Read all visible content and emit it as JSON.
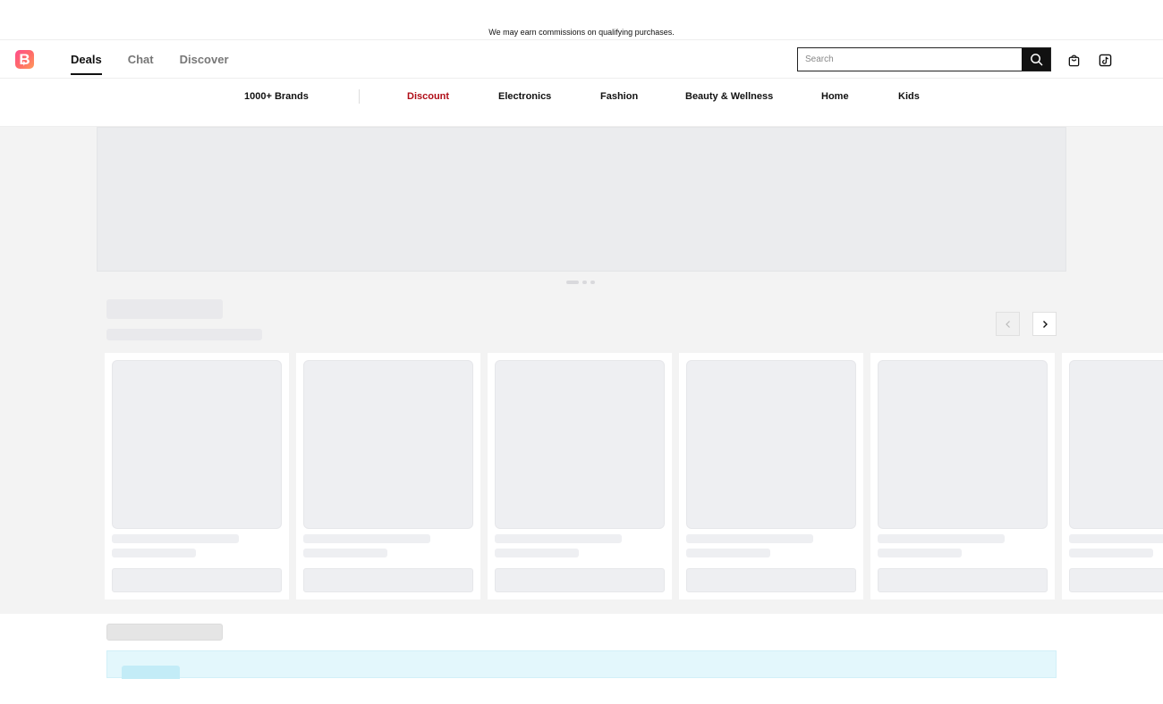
{
  "disclaimer": "We may earn commissions on qualifying purchases.",
  "logo": {
    "letter": "B"
  },
  "main_tabs": [
    {
      "label": "Deals",
      "active": true
    },
    {
      "label": "Chat",
      "active": false
    },
    {
      "label": "Discover",
      "active": false
    }
  ],
  "search": {
    "placeholder": "Search",
    "value": ""
  },
  "icons": {
    "search": "search-icon",
    "cart": "shopping-bag-icon",
    "tiktok": "tiktok-icon",
    "prev": "chevron-left-icon",
    "next": "chevron-right-icon"
  },
  "categories": [
    {
      "label": "1000+ Brands",
      "highlight": false
    },
    {
      "label": "Discount",
      "highlight": true
    },
    {
      "label": "Electronics",
      "highlight": false
    },
    {
      "label": "Fashion",
      "highlight": false
    },
    {
      "label": "Beauty & Wellness",
      "highlight": false
    },
    {
      "label": "Home",
      "highlight": false
    },
    {
      "label": "Kids",
      "highlight": false
    }
  ],
  "colors": {
    "accent_red": "#b00d17",
    "skeleton": "#eeeff2",
    "promo_bg": "#e3f7fc",
    "logo_gradient_start": "#ff4d8d",
    "logo_gradient_end": "#ff9a5a"
  }
}
